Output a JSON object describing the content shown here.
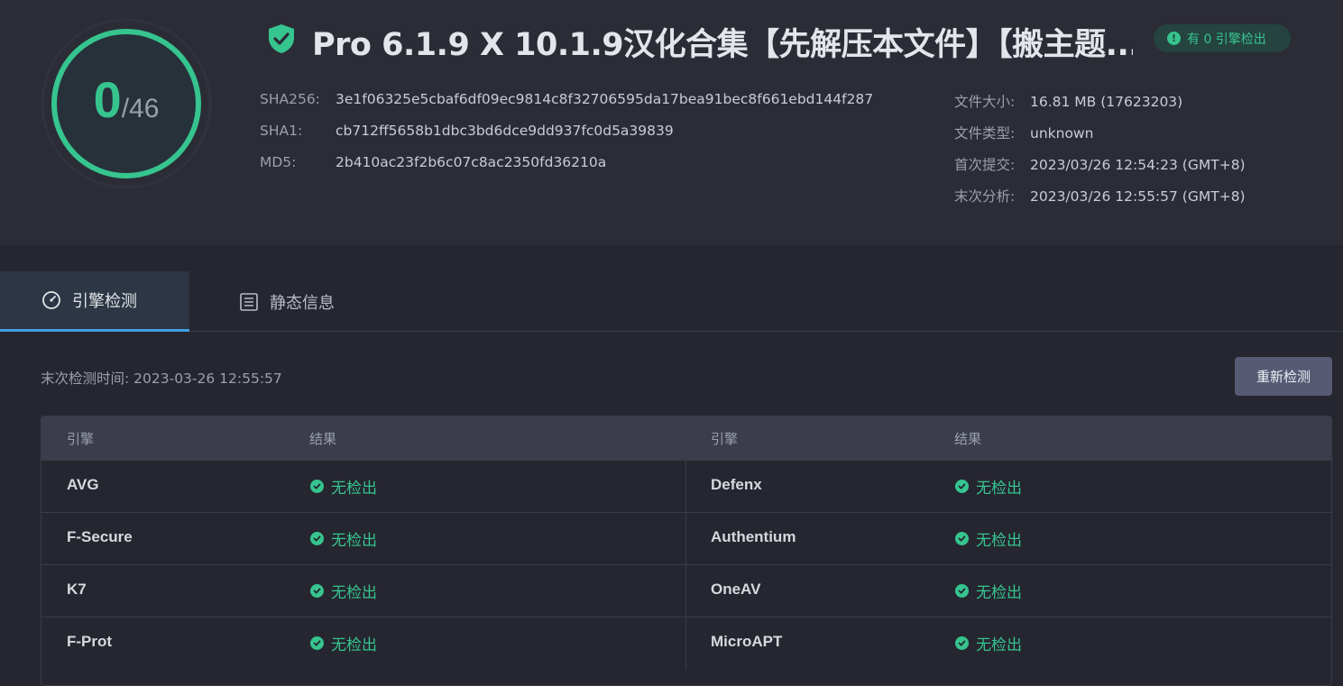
{
  "score": {
    "detected": "0",
    "total": "/46"
  },
  "file": {
    "title": "Pro 6.1.9 X 10.1.9汉化合集【先解压本文件】【搬主题...",
    "badge": "有 0 引擎检出"
  },
  "hashes": [
    {
      "label": "SHA256:",
      "value": "3e1f06325e5cbaf6df09ec9814c8f32706595da17bea91bec8f661ebd144f287"
    },
    {
      "label": "SHA1:",
      "value": "cb712ff5658b1dbc3bd6dce9dd937fc0d5a39839"
    },
    {
      "label": "MD5:",
      "value": "2b410ac23f2b6c07c8ac2350fd36210a"
    }
  ],
  "info": [
    {
      "label": "文件大小:",
      "value": "16.81 MB (17623203)"
    },
    {
      "label": "文件类型:",
      "value": "unknown"
    },
    {
      "label": "首次提交:",
      "value": "2023/03/26 12:54:23 (GMT+8)"
    },
    {
      "label": "末次分析:",
      "value": "2023/03/26 12:55:57 (GMT+8)"
    }
  ],
  "tabs": {
    "engine": "引擎检测",
    "static": "静态信息"
  },
  "last_check": "末次检测时间: 2023-03-26 12:55:57",
  "rescan": "重新检测",
  "table": {
    "headers": {
      "engine": "引擎",
      "result": "结果"
    },
    "rows": [
      {
        "left_engine": "AVG",
        "left_result": "无检出",
        "right_engine": "Defenx",
        "right_result": "无检出"
      },
      {
        "left_engine": "F-Secure",
        "left_result": "无检出",
        "right_engine": "Authentium",
        "right_result": "无检出"
      },
      {
        "left_engine": "K7",
        "left_result": "无检出",
        "right_engine": "OneAV",
        "right_result": "无检出"
      },
      {
        "left_engine": "F-Prot",
        "left_result": "无检出",
        "right_engine": "MicroAPT",
        "right_result": "无检出"
      }
    ]
  },
  "colors": {
    "accent": "#36c48f",
    "tab_underline": "#3fa0e0",
    "background": "#25262f"
  },
  "icons": [
    "shield-check-icon",
    "alert-icon",
    "gauge-icon",
    "list-icon",
    "check-circle-icon"
  ]
}
